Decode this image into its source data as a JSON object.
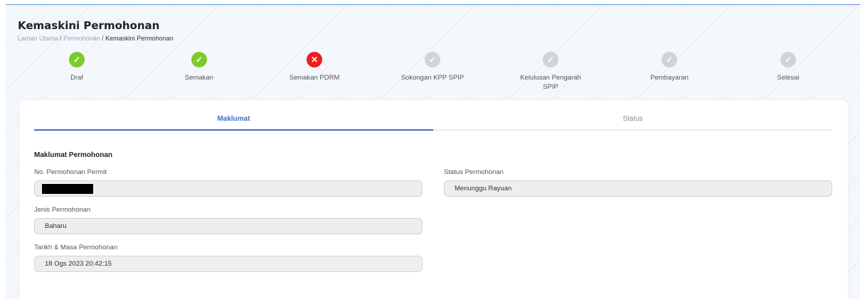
{
  "header": {
    "title": "Kemaskini Permohonan",
    "breadcrumb": {
      "home": "Laman Utama",
      "sep1": "/",
      "section": "Permohonan",
      "sep2": "/",
      "current": "Kemaskini Permohonan"
    }
  },
  "steps": [
    {
      "label": "Draf",
      "status": "done",
      "icon": "check-icon"
    },
    {
      "label": "Semakan",
      "status": "done",
      "icon": "check-icon"
    },
    {
      "label": "Semakan PDRM",
      "status": "fail",
      "icon": "cross-icon"
    },
    {
      "label": "Sokongan KPP SPIP",
      "status": "pending",
      "icon": "check-icon"
    },
    {
      "label": "Kelulusan Pengarah SPIP",
      "status": "pending",
      "icon": "check-icon"
    },
    {
      "label": "Pembayaran",
      "status": "pending",
      "icon": "check-icon"
    },
    {
      "label": "Selesai",
      "status": "pending",
      "icon": "check-icon"
    }
  ],
  "tabs": {
    "maklumat": "Maklumat",
    "status": "Status"
  },
  "form": {
    "section_title": "Maklumat Permohonan",
    "no_permohonan": {
      "label": "No. Permohonan Permit",
      "value": ""
    },
    "status_permohonan": {
      "label": "Status Permohonan",
      "value": "Menunggu Rayuan"
    },
    "jenis_permohonan": {
      "label": "Jenis Permohonan",
      "value": "Baharu"
    },
    "tarikh_masa": {
      "label": "Tarikh & Masa Permohonan",
      "value": "18 Ogs 2023 20:42:15"
    }
  },
  "colors": {
    "done": "#7ccb2a",
    "fail": "#ee1c1c",
    "pending": "#cfd3da",
    "accent": "#3f6fc8"
  }
}
